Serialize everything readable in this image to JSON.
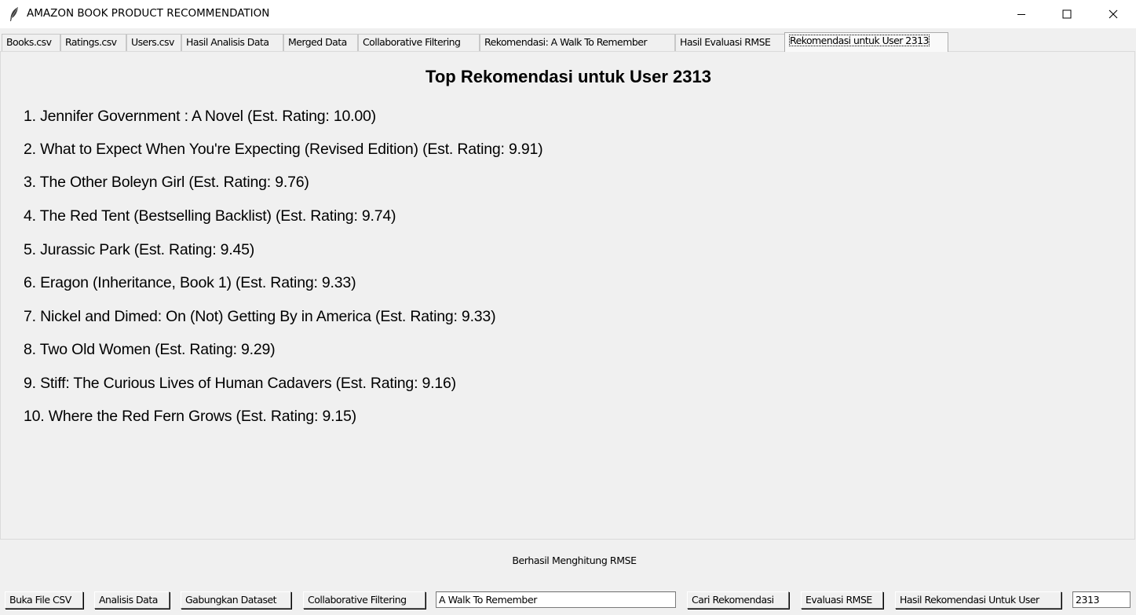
{
  "window": {
    "title": "AMAZON BOOK PRODUCT RECOMMENDATION",
    "icon": "feather-icon",
    "controls": {
      "minimize": "minimize-icon",
      "maximize": "maximize-icon",
      "close": "close-icon"
    }
  },
  "tabs": [
    {
      "label": "Books.csv",
      "active": false
    },
    {
      "label": "Ratings.csv",
      "active": false
    },
    {
      "label": "Users.csv",
      "active": false
    },
    {
      "label": "Hasil Analisis Data",
      "active": false
    },
    {
      "label": "Merged Data",
      "active": false
    },
    {
      "label": "Collaborative Filtering",
      "active": false
    },
    {
      "label": "Rekomendasi: A Walk To Remember",
      "active": false
    },
    {
      "label": "Hasil Evaluasi RMSE",
      "active": false
    },
    {
      "label": "Rekomendasi untuk User 2313",
      "active": true
    }
  ],
  "content": {
    "heading": "Top Rekomendasi untuk User 2313",
    "recommendations": [
      "1. Jennifer Government : A Novel (Est. Rating: 10.00)",
      "2. What to Expect When You're Expecting (Revised Edition) (Est. Rating: 9.91)",
      "3. The Other Boleyn Girl (Est. Rating: 9.76)",
      "4. The Red Tent (Bestselling Backlist) (Est. Rating: 9.74)",
      "5. Jurassic Park (Est. Rating: 9.45)",
      "6. Eragon (Inheritance, Book 1) (Est. Rating: 9.33)",
      "7. Nickel and Dimed: On (Not) Getting By in America (Est. Rating: 9.33)",
      "8. Two Old Women (Est. Rating: 9.29)",
      "9. Stiff: The Curious Lives of Human Cadavers (Est. Rating: 9.16)",
      "10. Where the Red Fern Grows (Est. Rating: 9.15)"
    ]
  },
  "status": "Berhasil Menghitung RMSE",
  "toolbar": {
    "open_csv": "Buka File CSV",
    "analyze": "Analisis Data",
    "merge": "Gabungkan Dataset",
    "collab": "Collaborative Filtering",
    "book_title_value": "A Walk To Remember",
    "find_rec": "Cari Rekomendasi",
    "eval_rmse": "Evaluasi RMSE",
    "user_rec": "Hasil Rekomendasi Untuk User",
    "user_id_value": "2313"
  }
}
